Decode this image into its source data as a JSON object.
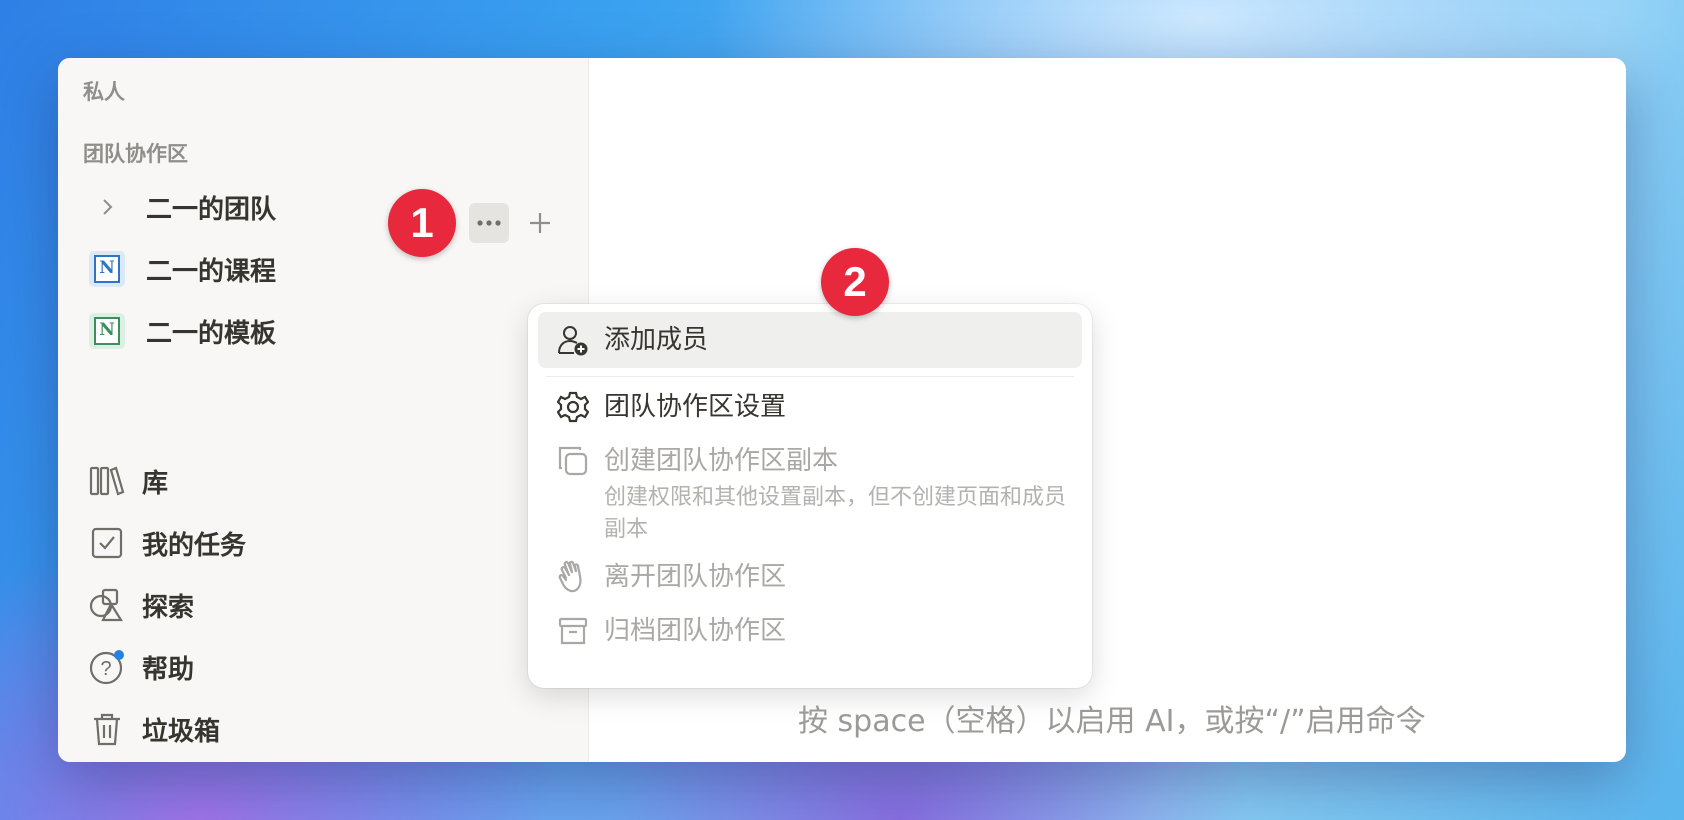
{
  "sidebar": {
    "private_title": "私人",
    "teamspace_title": "团队协作区",
    "teamspaces": [
      {
        "label": "二一的团队",
        "icon": "chevron-right-icon"
      },
      {
        "label": "二一的课程",
        "icon": "notion-logo-icon",
        "color": "#2e75c8"
      },
      {
        "label": "二一的模板",
        "icon": "notion-logo-icon",
        "color": "#3f8f5e"
      }
    ],
    "bottom": [
      {
        "label": "库",
        "icon": "library-icon"
      },
      {
        "label": "我的任务",
        "icon": "checkbox-icon"
      },
      {
        "label": "探索",
        "icon": "explore-shapes-icon"
      },
      {
        "label": "帮助",
        "icon": "help-icon",
        "badge_color": "#2383e2"
      },
      {
        "label": "垃圾箱",
        "icon": "trash-icon"
      }
    ]
  },
  "markers": {
    "one": "1",
    "two": "2",
    "color": "#e8283c"
  },
  "menu": {
    "add_member": "添加成员",
    "settings": "团队协作区设置",
    "duplicate": "创建团队协作区副本",
    "duplicate_desc": "创建权限和其他设置副本，但不创建页面和成员副本",
    "leave": "离开团队协作区",
    "archive": "归档团队协作区"
  },
  "editor": {
    "hint": "按 space（空格）以启用 AI，或按“/”启用命令"
  }
}
